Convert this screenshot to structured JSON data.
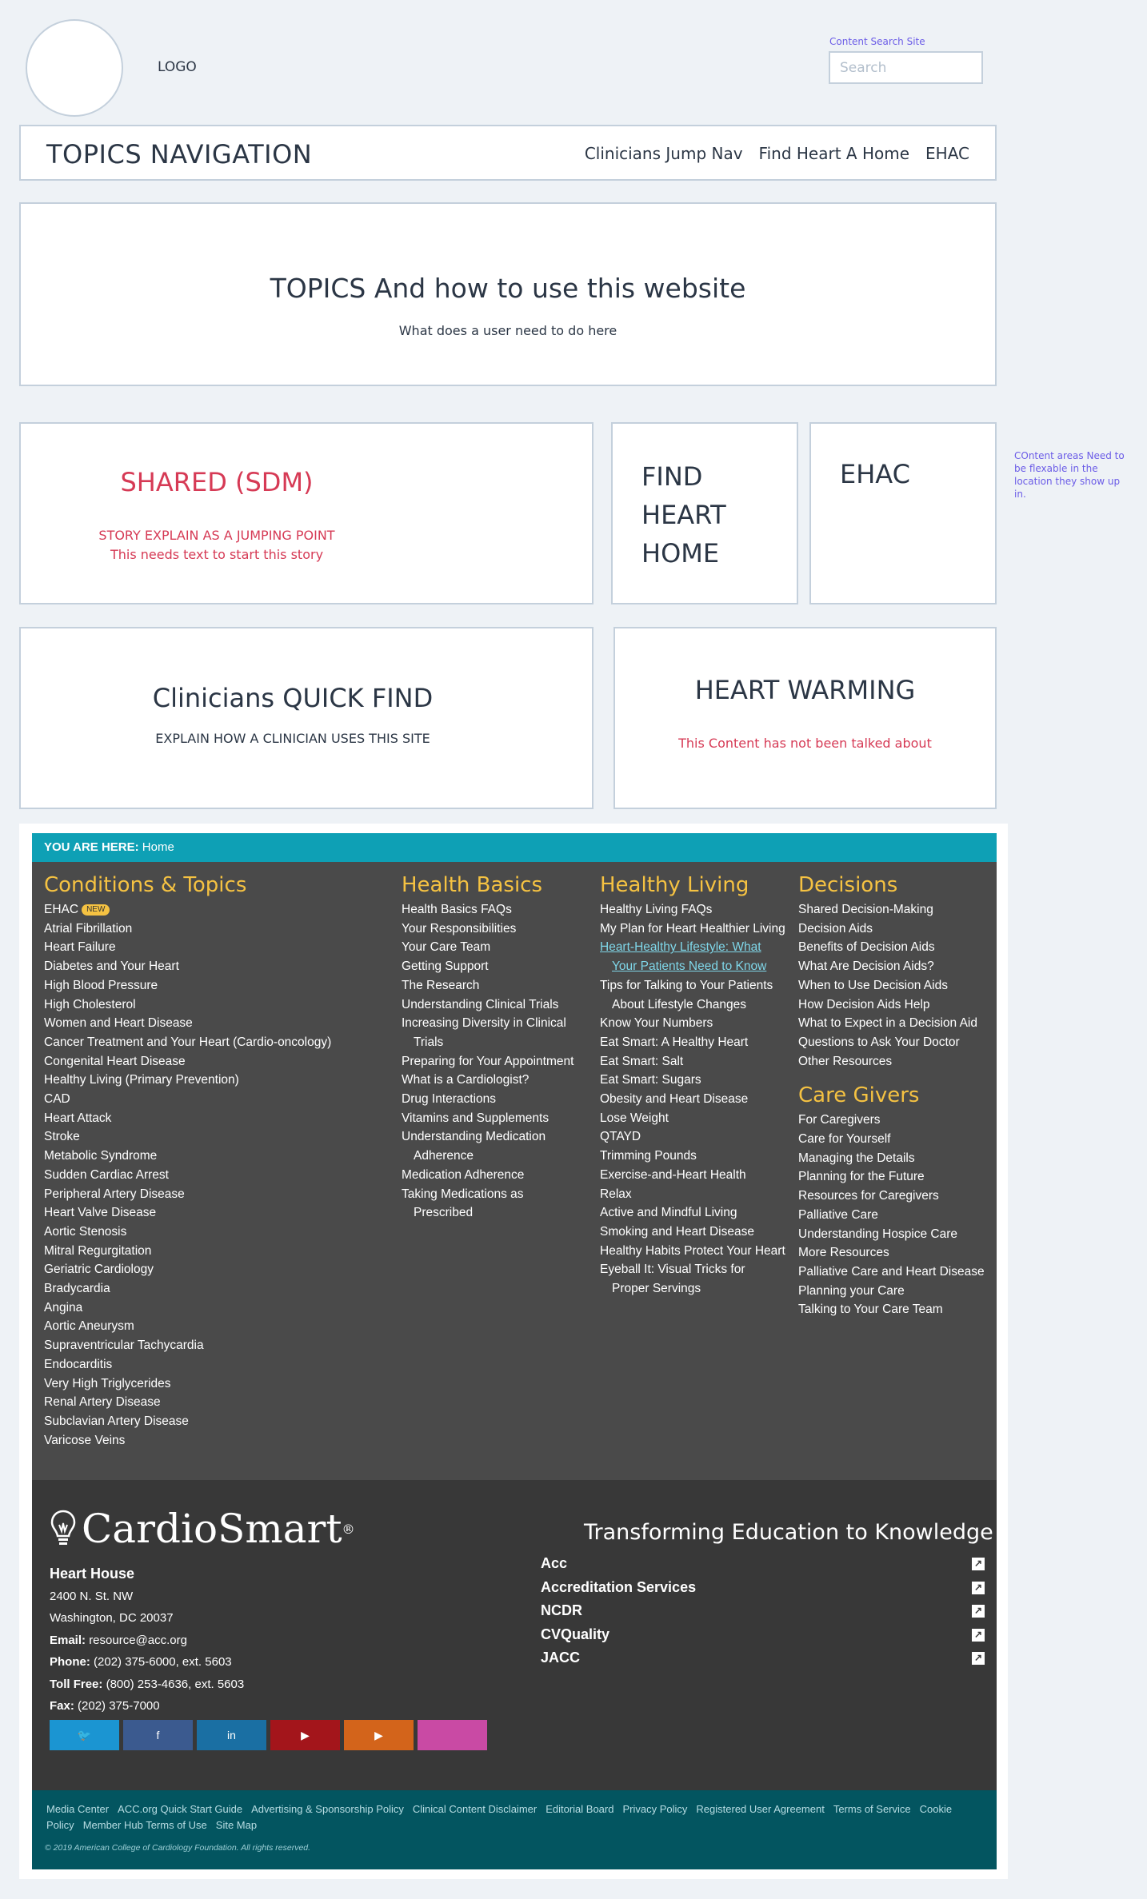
{
  "header": {
    "logo_label": "LOGO",
    "search_label": "Content Search Site",
    "search_placeholder": "Search"
  },
  "topics_nav": {
    "title": "TOPICS NAVIGATION",
    "links": [
      "Clinicians Jump Nav",
      "Find Heart A Home",
      "EHAC"
    ]
  },
  "hero": {
    "title": "TOPICS And how to use this website",
    "subtitle": "What does a user need to do here"
  },
  "shared_sdm": {
    "title": "SHARED (SDM)",
    "line1": "STORY EXPLAIN AS A JUMPING POINT",
    "line2": "This needs text to start this story"
  },
  "find_heart_home": {
    "title": "FIND HEART HOME"
  },
  "ehac_card": {
    "title": "EHAC"
  },
  "side_note": {
    "text": "COntent areas Need to be flexable in the location they show up in."
  },
  "clinicians_quick_find": {
    "title": "Clinicians QUICK FIND",
    "subtitle": "EXPLAIN HOW A CLINICIAN  USES THIS SITE"
  },
  "heart_warming": {
    "title": "HEART WARMING",
    "subtitle": "This Content has not been talked about"
  },
  "breadcrumb": {
    "label": "YOU ARE HERE:",
    "current": "Home"
  },
  "sitemap": {
    "conditions": {
      "title": "Conditions & Topics",
      "badge": "NEW",
      "items": [
        "EHAC",
        "Atrial Fibrillation",
        "Heart Failure",
        "Diabetes and Your Heart",
        "High Blood Pressure",
        "High Cholesterol",
        "Women and Heart Disease",
        "Cancer Treatment and Your Heart (Cardio-oncology)",
        "Congenital Heart Disease",
        "Healthy Living (Primary Prevention)",
        "CAD",
        "Heart Attack",
        "Stroke",
        "Metabolic Syndrome",
        "Sudden Cardiac Arrest",
        "Peripheral Artery Disease",
        "Heart Valve Disease",
        "Aortic Stenosis",
        "Mitral Regurgitation",
        "Geriatric Cardiology",
        "Bradycardia",
        "Angina",
        "Aortic Aneurysm",
        "Supraventricular Tachycardia",
        "Endocarditis",
        "Very High Triglycerides",
        "Renal Artery Disease",
        "Subclavian Artery Disease",
        "Varicose Veins"
      ]
    },
    "health_basics": {
      "title": "Health Basics",
      "items": [
        "Health Basics FAQs",
        "Your Responsibilities",
        "Your Care Team",
        "Getting Support",
        "The Research",
        "Understanding Clinical Trials",
        "Increasing Diversity in Clinical Trials",
        "Preparing for Your Appointment",
        "What is a Cardiologist?",
        "Drug Interactions",
        "Vitamins and Supplements",
        "Understanding Medication Adherence",
        "Medication Adherence",
        "Taking Medications as Prescribed"
      ]
    },
    "healthy_living": {
      "title": "Healthy Living",
      "items": [
        "Healthy Living FAQs",
        "My Plan for Heart Healthier Living",
        "Heart-Healthy Lifestyle: What Your Patients Need to Know",
        "Tips for Talking to Your Patients About Lifestyle Changes",
        "Know Your Numbers",
        "Eat Smart: A Healthy Heart",
        "Eat Smart: Salt",
        "Eat Smart: Sugars",
        "Obesity and Heart Disease",
        "Lose Weight",
        "QTAYD",
        "Trimming Pounds",
        "Exercise-and-Heart Health",
        "Relax",
        "Active and Mindful Living",
        "Smoking and Heart Disease",
        "Healthy Habits Protect Your Heart",
        "Eyeball It: Visual Tricks for Proper Servings"
      ]
    },
    "decisions": {
      "title": "Decisions",
      "items": [
        "Shared Decision-Making",
        "Decision Aids",
        "Benefits of Decision Aids",
        "What Are Decision Aids?",
        "When to Use Decision Aids",
        "How Decision Aids Help",
        "What to Expect in a Decision Aid",
        "Questions to Ask Your Doctor",
        "Other Resources"
      ]
    },
    "care_givers": {
      "title": "Care Givers",
      "items": [
        "For Caregivers",
        "Care for Yourself",
        "Managing the Details",
        "Planning for the Future",
        "Resources for Caregivers",
        "Palliative Care",
        "Understanding Hospice Care",
        "More Resources",
        "Palliative Care and Heart Disease",
        "Planning your Care",
        "Talking to Your Care Team"
      ]
    }
  },
  "footer": {
    "brand": "CardioSmart",
    "brand_mark": "®",
    "org_name": "Heart House",
    "street": "2400 N. St. NW",
    "city": "Washington, DC 20037",
    "email_label": "Email:",
    "email": "resource@acc.org",
    "phone_label": "Phone:",
    "phone": "(202) 375-6000, ext. 5603",
    "tollfree_label": "Toll Free:",
    "tollfree": "(800) 253-4636, ext. 5603",
    "fax_label": "Fax:",
    "fax": "(202) 375-7000",
    "social": [
      {
        "name": "twitter-icon",
        "glyph": "🐦",
        "color": "#1b95d2"
      },
      {
        "name": "facebook-icon",
        "glyph": "f",
        "color": "#3b5a8f"
      },
      {
        "name": "linkedin-icon",
        "glyph": "in",
        "color": "#1a6fa3"
      },
      {
        "name": "youtube-icon",
        "glyph": "▶",
        "color": "#a3151b"
      },
      {
        "name": "google-play-icon",
        "glyph": "▶",
        "color": "#d3641b"
      },
      {
        "name": "apple-icon",
        "glyph": "",
        "color": "#c94aa4"
      }
    ],
    "tagline": "Transforming Education to Knowledge",
    "orgs": [
      "Acc",
      "Accreditation Services",
      "NCDR",
      "CVQuality",
      "JACC"
    ],
    "bottom_links": [
      "Media Center",
      "ACC.org Quick Start Guide",
      "Advertising & Sponsorship Policy",
      "Clinical Content Disclaimer",
      "Editorial Board",
      "Privacy Policy",
      "Registered User Agreement",
      "Terms of Service",
      "Cookie Policy",
      "Member Hub Terms of Use",
      "Site Map"
    ],
    "copyright": "© 2019 American College of Cardiology Foundation. All rights reserved."
  },
  "colors": {
    "accent_red": "#d63a55",
    "note_purple": "#6b5ce7",
    "breadcrumb_teal": "#0ea0b5",
    "heading_yellow": "#f5c242",
    "bottom_bar": "#035560"
  }
}
